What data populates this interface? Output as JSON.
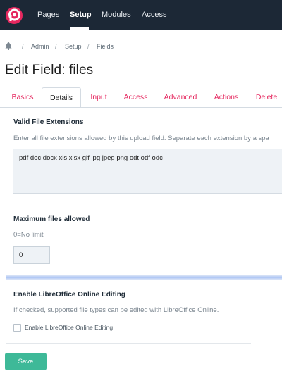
{
  "topnav": {
    "items": [
      {
        "label": "Pages"
      },
      {
        "label": "Setup",
        "active": true
      },
      {
        "label": "Modules"
      },
      {
        "label": "Access"
      }
    ]
  },
  "breadcrumb": {
    "items": [
      "Admin",
      "Setup",
      "Fields"
    ],
    "separator": "/"
  },
  "page": {
    "title": "Edit Field: files"
  },
  "tabs": [
    {
      "label": "Basics"
    },
    {
      "label": "Details",
      "active": true
    },
    {
      "label": "Input"
    },
    {
      "label": "Access"
    },
    {
      "label": "Advanced"
    },
    {
      "label": "Actions"
    },
    {
      "label": "Delete"
    }
  ],
  "fields": {
    "extensions": {
      "label": "Valid File Extensions",
      "description": "Enter all file extensions allowed by this upload field. Separate each extension by a spa",
      "value": "pdf doc docx xls xlsx gif jpg jpeg png odt odf odc"
    },
    "max_files": {
      "label": "Maximum files allowed",
      "description": "0=No limit",
      "value": "0"
    },
    "libreoffice": {
      "label": "Enable LibreOffice Online Editing",
      "description": "If checked, supported file types can be edited with LibreOffice Online.",
      "checkbox_label": "Enable LibreOffice Online Editing",
      "checked": false
    }
  },
  "actions": {
    "save_label": "Save"
  },
  "colors": {
    "topbar": "#1c2836",
    "brand": "#e5285f",
    "tab_link": "#e5285f",
    "save_button": "#3eb998"
  },
  "icons": {
    "logo": "processwire-logo-icon",
    "home": "tree-icon"
  }
}
